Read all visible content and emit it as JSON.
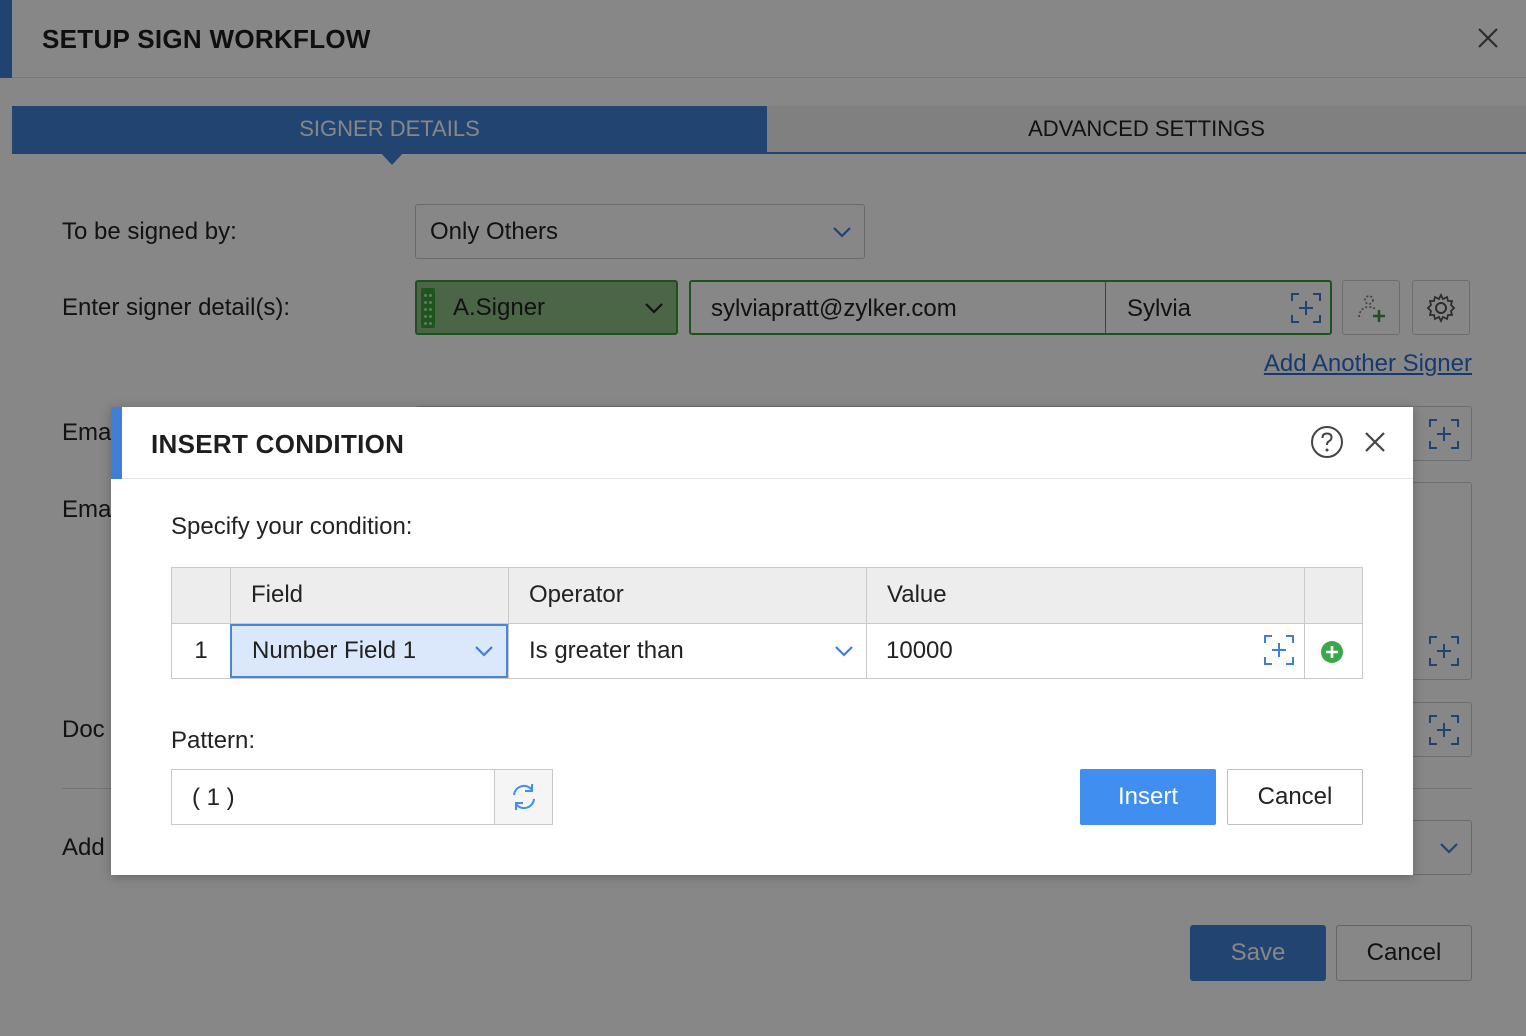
{
  "workflow": {
    "title": "SETUP SIGN WORKFLOW",
    "tabs": [
      {
        "label": "SIGNER DETAILS",
        "active": true
      },
      {
        "label": "ADVANCED SETTINGS",
        "active": false
      }
    ],
    "signed_by": {
      "label": "To be signed by:",
      "value": "Only Others"
    },
    "signer_detail": {
      "label": "Enter signer detail(s):",
      "role": "A.Signer",
      "email": "sylviapratt@zylker.com",
      "name": "Sylvia"
    },
    "add_signer_link": "Add Another Signer",
    "partial_labels": [
      "Ema",
      "Ema",
      "Doc",
      "Add"
    ],
    "save_label": "Save",
    "cancel_label": "Cancel"
  },
  "modal": {
    "title": "INSERT CONDITION",
    "specify_label": "Specify your condition:",
    "table": {
      "headers": [
        "Field",
        "Operator",
        "Value"
      ],
      "rows": [
        {
          "num": "1",
          "field": "Number Field 1",
          "operator": "Is greater than",
          "value": "10000"
        }
      ]
    },
    "pattern_label": "Pattern:",
    "pattern_value": "( 1 )",
    "insert_label": "Insert",
    "cancel_label": "Cancel"
  },
  "colors": {
    "accent": "#3f80d6",
    "insert_button": "#3f8ef0",
    "signer_green": "#3a9a3a",
    "add_icon_green": "#3aa84a"
  }
}
